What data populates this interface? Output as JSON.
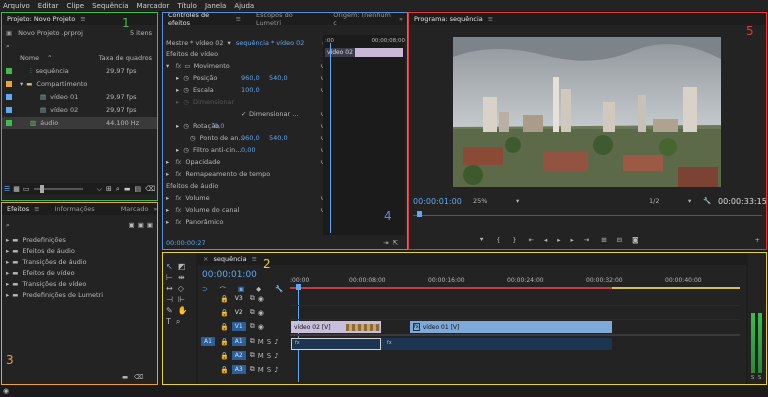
{
  "menu": [
    "Arquivo",
    "Editar",
    "Clipe",
    "Sequência",
    "Marcador",
    "Título",
    "Janela",
    "Ajuda"
  ],
  "project": {
    "tab": "Projeto: Novo Projeto",
    "file": "Novo Projeto .prproj",
    "count": "5 itens",
    "col_name": "Nome",
    "col_rate": "Taxa de quadros",
    "items": [
      {
        "name": "sequência",
        "rate": "29,97 fps",
        "color": "#3dbd4e"
      },
      {
        "name": "Compartimento",
        "rate": "",
        "color": "#e8a33b"
      },
      {
        "name": "vídeo 01",
        "rate": "29,97 fps",
        "color": "#5fa8f5"
      },
      {
        "name": "vídeo 02",
        "rate": "29,97 fps",
        "color": "#5fa8f5"
      },
      {
        "name": "áudio",
        "rate": "44.100 Hz",
        "color": "#3dbd4e"
      }
    ]
  },
  "effects_panel": {
    "tabs": [
      "Efeitos",
      "Informações",
      "Marcado"
    ],
    "items": [
      "Predefinições",
      "Efeitos de áudio",
      "Transições de áudio",
      "Efeitos de vídeo",
      "Transições de vídeo",
      "Predefinições de Lumetri"
    ]
  },
  "effect_controls": {
    "tabs": [
      "Controles de efeitos",
      "Escopos do Lumetri",
      "Origem: (nenhum c"
    ],
    "master": "Mestre * vídeo 02",
    "seq": "sequência * vídeo 02",
    "tc_start": ":00",
    "tc_end": "00;00;08;00",
    "clip_label": "vídeo 02",
    "video_fx": "Efeitos de vídeo",
    "motion": "Movimento",
    "pos_label": "Posição",
    "pos_x": "960,0",
    "pos_y": "540,0",
    "scale_label": "Escala",
    "scale": "100,0",
    "scale_w": "Dimensionar",
    "uniform": "Dimensionar ...",
    "rot_label": "Rotação",
    "rot": "0,0",
    "anchor_label": "Ponto de an...",
    "anchor_x": "960,0",
    "anchor_y": "540,0",
    "flicker_label": "Filtro anti-cin...",
    "flicker": "0,00",
    "opacity": "Opacidade",
    "remap": "Remapeamento de tempo",
    "audio_fx": "Efeitos de áudio",
    "volume": "Volume",
    "channel_volume": "Volume do canal",
    "pan": "Panorâmico",
    "timecode": "00:00:00:27"
  },
  "program": {
    "tab": "Programa: sequência",
    "timecode": "00:00:01:00",
    "zoom": "25%",
    "quality": "1/2",
    "duration": "00:00:33:15"
  },
  "timeline": {
    "tab": "sequência",
    "timecode": "00:00:01:00",
    "ruler": [
      ":00:00",
      "00:00:08:00",
      "00:00:16:00",
      "00:00:24:00",
      "00:00:32:00",
      "00:00:40:00"
    ],
    "tracks": [
      "V3",
      "V2",
      "V1",
      "A1",
      "A2",
      "A3"
    ],
    "src_v": "V1",
    "src_a": "A1",
    "clip_a": "vídeo 02 [V]",
    "clip_b": "vídeo 01 [V]",
    "meter_scale": [
      "S",
      "S"
    ]
  },
  "annotations": {
    "n1": "1",
    "n2": "2",
    "n3": "3",
    "n4": "4",
    "n5": "5",
    "c1": "#3dbd4e",
    "c2": "#e8d23b",
    "c3": "#e8a33b",
    "c4": "#5b8fd8",
    "c5": "#e03a3a"
  }
}
